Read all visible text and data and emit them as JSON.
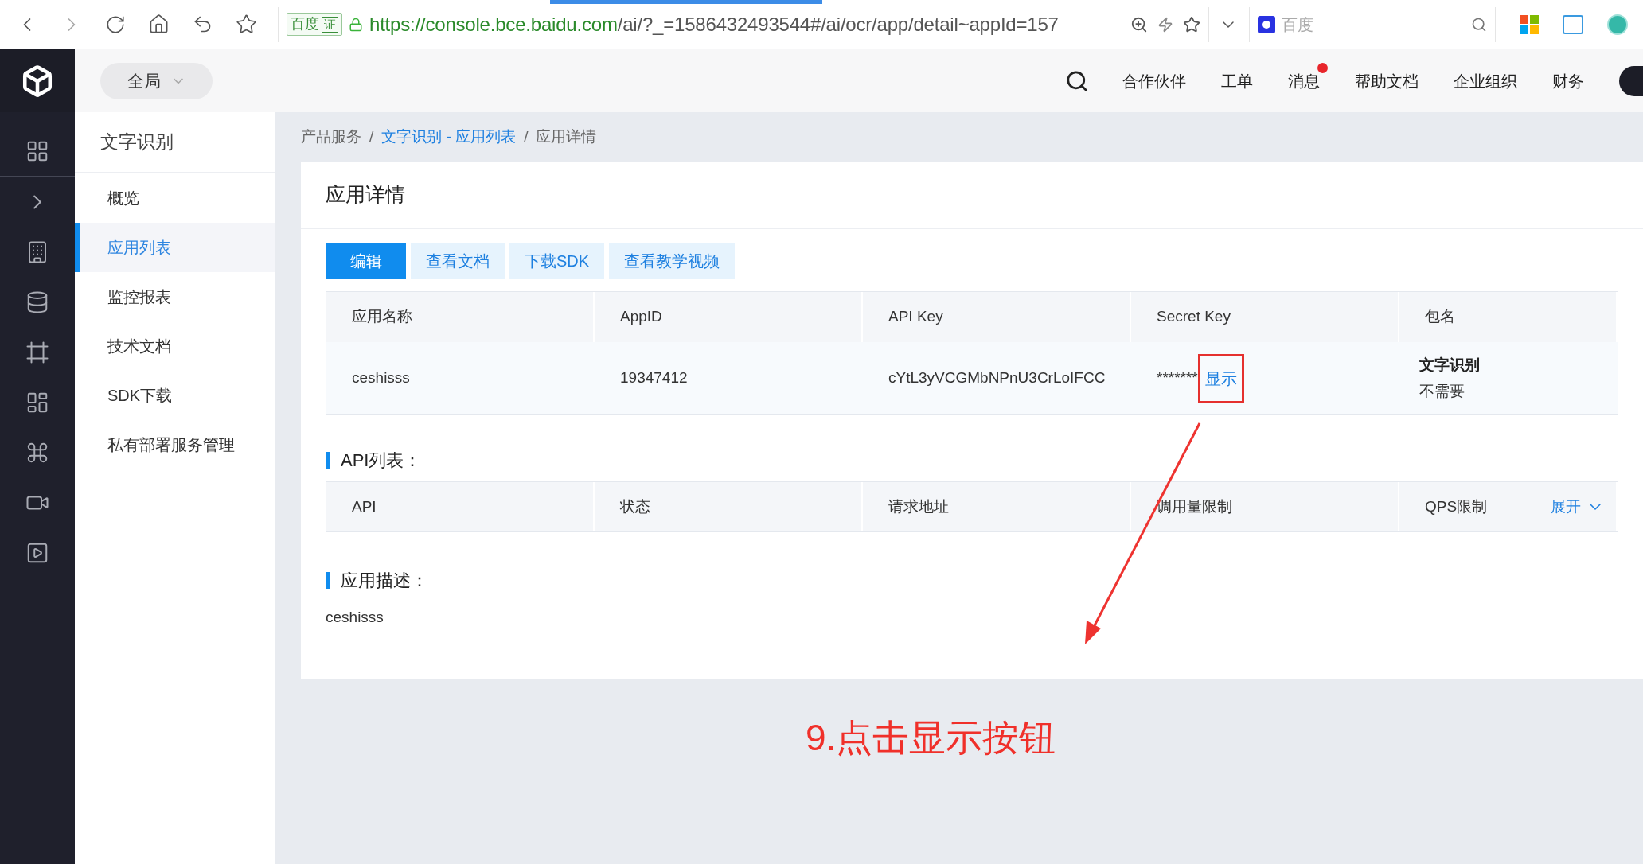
{
  "browser": {
    "site_badge": "百度",
    "cert_badge": "证",
    "url_host": "https://console.bce.baidu.com",
    "url_path": "/ai/?_=1586432493544#/ai/ocr/app/detail~appId=157",
    "search_placeholder": "百度"
  },
  "header": {
    "scope": "全局",
    "nav": [
      {
        "label": "合作伙伴",
        "unread": false
      },
      {
        "label": "工单",
        "unread": false
      },
      {
        "label": "消息",
        "unread": true
      },
      {
        "label": "帮助文档",
        "unread": false
      },
      {
        "label": "企业组织",
        "unread": false
      },
      {
        "label": "财务",
        "unread": false
      }
    ]
  },
  "sidebar": {
    "title": "文字识别",
    "items": [
      {
        "label": "概览",
        "selected": false
      },
      {
        "label": "应用列表",
        "selected": true
      },
      {
        "label": "监控报表",
        "selected": false
      },
      {
        "label": "技术文档",
        "selected": false
      },
      {
        "label": "SDK下载",
        "selected": false
      },
      {
        "label": "私有部署服务管理",
        "selected": false
      }
    ]
  },
  "breadcrumb": [
    {
      "label": "产品服务",
      "link": false,
      "separator": "/"
    },
    {
      "label": "文字识别 - 应用列表",
      "link": true,
      "separator": "/"
    },
    {
      "label": "应用详情",
      "link": false
    }
  ],
  "card": {
    "title": "应用详情",
    "actions": [
      {
        "label": "编辑",
        "primary": true
      },
      {
        "label": "查看文档",
        "primary": false
      },
      {
        "label": "下载SDK",
        "primary": false
      },
      {
        "label": "查看教学视频",
        "primary": false
      }
    ],
    "app_table": {
      "columns": [
        "应用名称",
        "AppID",
        "API Key",
        "Secret Key",
        "包名"
      ],
      "row": {
        "name": "ceshisss",
        "app_id": "19347412",
        "api_key": "cYtL3yVCGMbNPnU3CrLoIFCC",
        "secret_mask": "*******",
        "secret_action": "显示",
        "package_title": "文字识别",
        "package_value": "不需要"
      }
    },
    "api_section": {
      "title": "API列表：",
      "columns": [
        "API",
        "状态",
        "请求地址",
        "调用量限制",
        "QPS限制"
      ],
      "expand": "展开"
    },
    "desc_section": {
      "title": "应用描述：",
      "text": "ceshisss"
    }
  },
  "annotation": {
    "text": "9.点击显示按钮"
  }
}
